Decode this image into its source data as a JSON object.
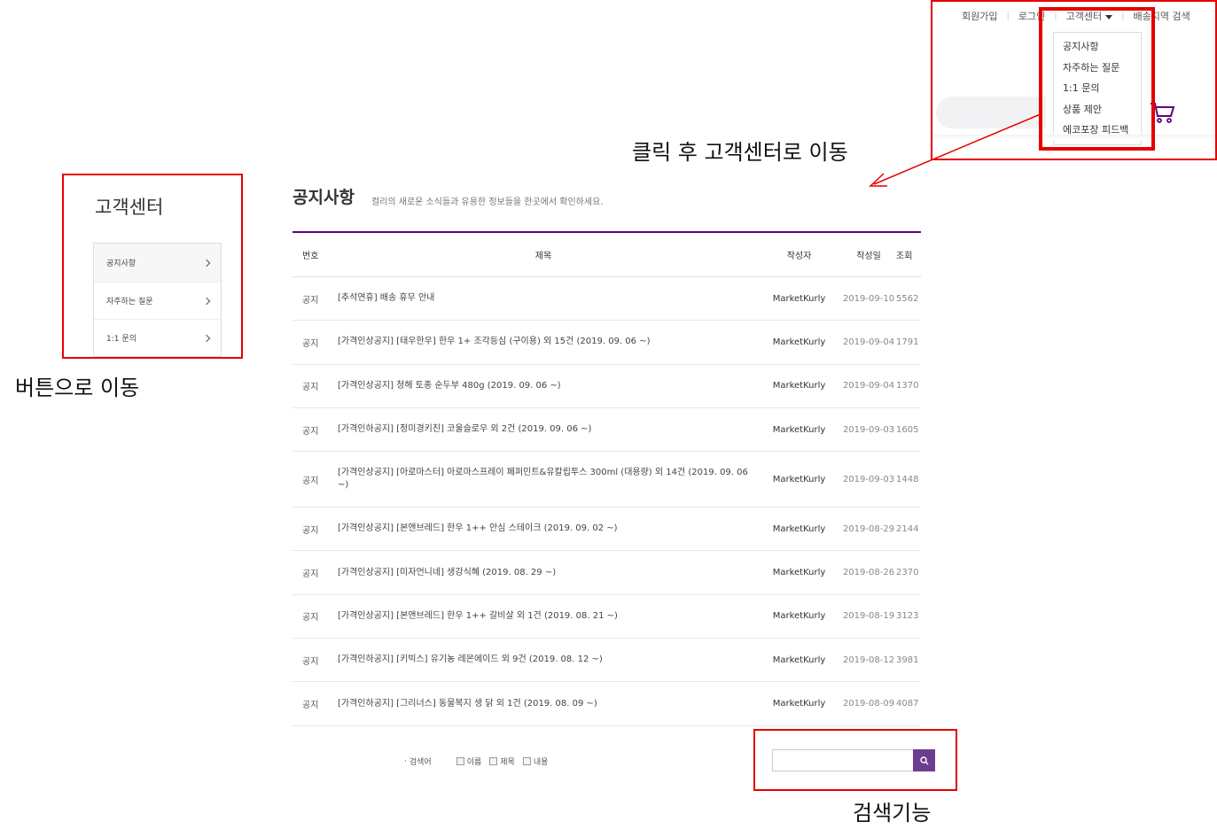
{
  "top_nav": {
    "signup": "회원가입",
    "login": "로그인",
    "customer_center": "고객센터",
    "delivery_search": "배송지역 검색"
  },
  "dropdown": {
    "items": [
      "공지사항",
      "자주하는 질문",
      "1:1 문의",
      "상품 제안",
      "에코포장 피드백"
    ]
  },
  "annotations": {
    "click_note": "클릭 후 고객센터로 이동",
    "button_note": "버튼으로 이동",
    "search_note": "검색기능",
    "highlight_color": "#e60000"
  },
  "sidebar": {
    "title": "고객센터",
    "items": [
      {
        "label": "공지사항"
      },
      {
        "label": "자주하는 질문"
      },
      {
        "label": "1:1 문의"
      }
    ]
  },
  "board": {
    "title": "공지사항",
    "description": "컬리의 새로운 소식들과 유용한 정보들을 한곳에서 확인하세요.",
    "headers": {
      "no": "번호",
      "title": "제목",
      "writer": "작성자",
      "date": "작성일",
      "views": "조회"
    },
    "rows": [
      {
        "no": "공지",
        "title": "[추석연휴] 배송 휴무 안내",
        "writer": "MarketKurly",
        "date": "2019-09-10",
        "views": "5562"
      },
      {
        "no": "공지",
        "title": "[가격인상공지] [태우한우] 한우 1+ 조각등심 (구이용) 외 15건 (2019. 09. 06 ~)",
        "writer": "MarketKurly",
        "date": "2019-09-04",
        "views": "1791"
      },
      {
        "no": "공지",
        "title": "[가격인상공지] 청해 토종 순두부 480g (2019. 09. 06 ~)",
        "writer": "MarketKurly",
        "date": "2019-09-04",
        "views": "1370"
      },
      {
        "no": "공지",
        "title": "[가격인하공지] [정미경키친] 코울슬로우 외 2건 (2019. 09. 06 ~)",
        "writer": "MarketKurly",
        "date": "2019-09-03",
        "views": "1605"
      },
      {
        "no": "공지",
        "title": "[가격인상공지] [아로마스터] 아로마스프레이 페퍼민트&유칼립투스 300ml (대용량) 외 14건 (2019. 09. 06 ~)",
        "writer": "MarketKurly",
        "date": "2019-09-03",
        "views": "1448"
      },
      {
        "no": "공지",
        "title": "[가격인상공지] [본앤브레드] 한우 1++ 안심 스테이크 (2019. 09. 02 ~)",
        "writer": "MarketKurly",
        "date": "2019-08-29",
        "views": "2144"
      },
      {
        "no": "공지",
        "title": "[가격인상공지] [미자언니네] 생강식혜 (2019. 08. 29 ~)",
        "writer": "MarketKurly",
        "date": "2019-08-26",
        "views": "2370"
      },
      {
        "no": "공지",
        "title": "[가격인상공지] [본앤브레드] 한우 1++ 갈비살 외 1건 (2019. 08. 21 ~)",
        "writer": "MarketKurly",
        "date": "2019-08-19",
        "views": "3123"
      },
      {
        "no": "공지",
        "title": "[가격인하공지] [키빅스] 유기농 레몬에이드 외 9건 (2019. 08. 12 ~)",
        "writer": "MarketKurly",
        "date": "2019-08-12",
        "views": "3981"
      },
      {
        "no": "공지",
        "title": "[가격인하공지] [그리너스] 동물복지 생 닭 외 1건 (2019. 08. 09 ~)",
        "writer": "MarketKurly",
        "date": "2019-08-09",
        "views": "4087"
      }
    ]
  },
  "search": {
    "label": "검색어",
    "options": [
      "이름",
      "제목",
      "내용"
    ],
    "input_value": "",
    "button_color": "#6b3d8f"
  },
  "brand_color": "#5f0080"
}
